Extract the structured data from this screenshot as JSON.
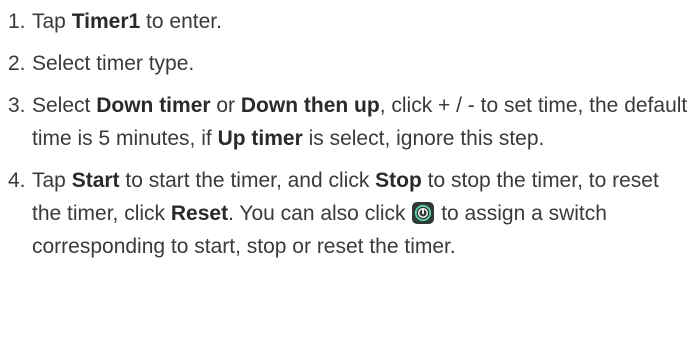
{
  "steps": [
    {
      "number": "1.",
      "a": "Tap ",
      "b": "Timer1",
      "c": " to enter."
    },
    {
      "number": "2.",
      "a": "Select timer type."
    },
    {
      "number": "3.",
      "a": "Select ",
      "b": "Down timer",
      "c": " or ",
      "d": "Down then up",
      "e": ", click + / -  to set time, the default time is 5 minutes, if ",
      "f": "Up timer",
      "g": " is select, ignore this step."
    },
    {
      "number": "4.",
      "a": "Tap ",
      "b": "Start",
      "c": " to start the timer, and click ",
      "d": "Stop",
      "e": " to stop the timer, to reset the timer, click ",
      "f": "Reset",
      "g": ". You can also click ",
      "icon": "switch-assign-icon",
      "h": " to assign a switch corresponding to start, stop or reset the timer."
    }
  ],
  "colors": {
    "text": "#3a3a3a",
    "icon_bg": "#2f3a36",
    "icon_accent": "#5fd3a8"
  }
}
